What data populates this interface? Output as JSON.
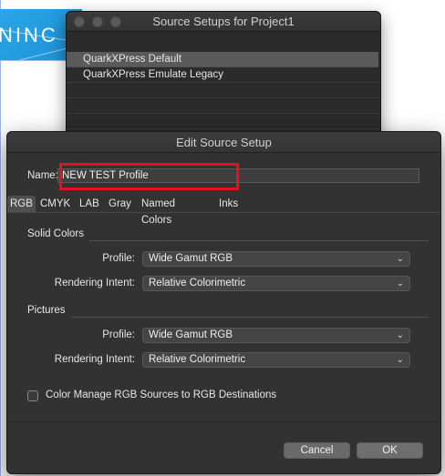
{
  "background_doc": {
    "banner_text": "NINC"
  },
  "setups_window": {
    "title": "Source Setups for Project1",
    "items": [
      {
        "label": "QuarkXPress Default",
        "selected": true
      },
      {
        "label": "QuarkXPress Emulate Legacy",
        "selected": false
      }
    ]
  },
  "edit_window": {
    "title": "Edit Source Setup",
    "name_label": "Name:",
    "name_value": "NEW TEST Profile",
    "highlight_color": "#e8111b",
    "tabs": [
      {
        "label": "RGB",
        "active": true
      },
      {
        "label": "CMYK",
        "active": false
      },
      {
        "label": "LAB",
        "active": false
      },
      {
        "label": "Gray",
        "active": false
      },
      {
        "label": "Named Colors",
        "active": false
      },
      {
        "label": "Inks",
        "active": false
      }
    ],
    "solid_colors": {
      "heading": "Solid Colors",
      "profile_label": "Profile:",
      "profile_value": "Wide Gamut RGB",
      "intent_label": "Rendering Intent:",
      "intent_value": "Relative Colorimetric"
    },
    "pictures": {
      "heading": "Pictures",
      "profile_label": "Profile:",
      "profile_value": "Wide Gamut RGB",
      "intent_label": "Rendering Intent:",
      "intent_value": "Relative Colorimetric"
    },
    "color_manage": {
      "label": "Color Manage RGB Sources to RGB Destinations",
      "checked": false
    },
    "buttons": {
      "cancel": "Cancel",
      "ok": "OK"
    }
  }
}
